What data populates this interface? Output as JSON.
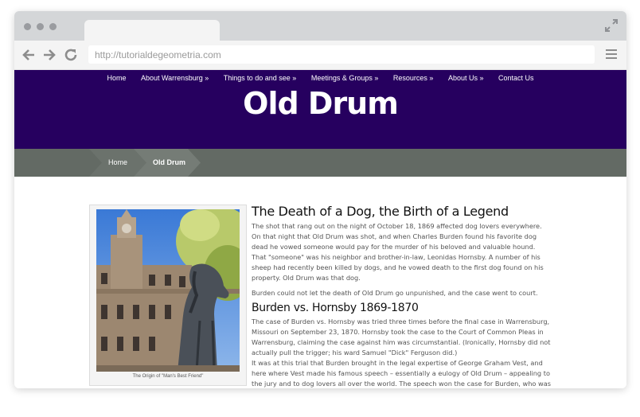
{
  "browser": {
    "url": "http://tutorialdegeometria.com"
  },
  "nav": {
    "items": [
      "Home",
      "About Warrensburg »",
      "Things to do and see »",
      "Meetings & Groups »",
      "Resources »",
      "About Us »",
      "Contact Us"
    ]
  },
  "site": {
    "title": "Old Drum"
  },
  "breadcrumb": {
    "home": "Home",
    "current": "Old Drum"
  },
  "figure": {
    "caption": "The Origin of \"Man's Best Friend\""
  },
  "article": {
    "heading1": "The Death of a Dog, the Birth of a Legend",
    "para1": "The shot that rang out on the night of October 18, 1869 affected dog lovers everywhere. On that night that Old Drum was shot, and when Charles Burden found his favorite dog dead he vowed someone would pay for the murder of his beloved and valuable hound.",
    "para2": "That \"someone\" was his neighbor and brother-in-law, Leonidas Hornsby. A number of his sheep had recently been killed by dogs, and he vowed death to the first dog found on his property. Old Drum was that dog.",
    "para3": "Burden could not let the death of Old Drum go unpunished, and the case went to court.",
    "heading2": "Burden vs. Hornsby 1869-1870",
    "para4": "The case of Burden vs. Hornsby was tried three times before the final case in Warrensburg, Missouri on September 23, 1870. Hornsby took the case to the Court of Common Pleas in Warrensburg, claiming the case against him was circumstantial. (Ironically, Hornsby did not actually pull the trigger; his ward Samuel \"Dick\" Ferguson did.)",
    "para5": "It was at this trial that Burden brought in the legal expertise of George Graham Vest, and here where Vest made his famous speech – essentially a eulogy of Old Drum – appealing to the jury and to dog lovers all over the world. The speech won the case for Burden, who was awarded"
  },
  "colors": {
    "header_bg": "#26005f",
    "breadcrumb_bg": "#636a64"
  }
}
